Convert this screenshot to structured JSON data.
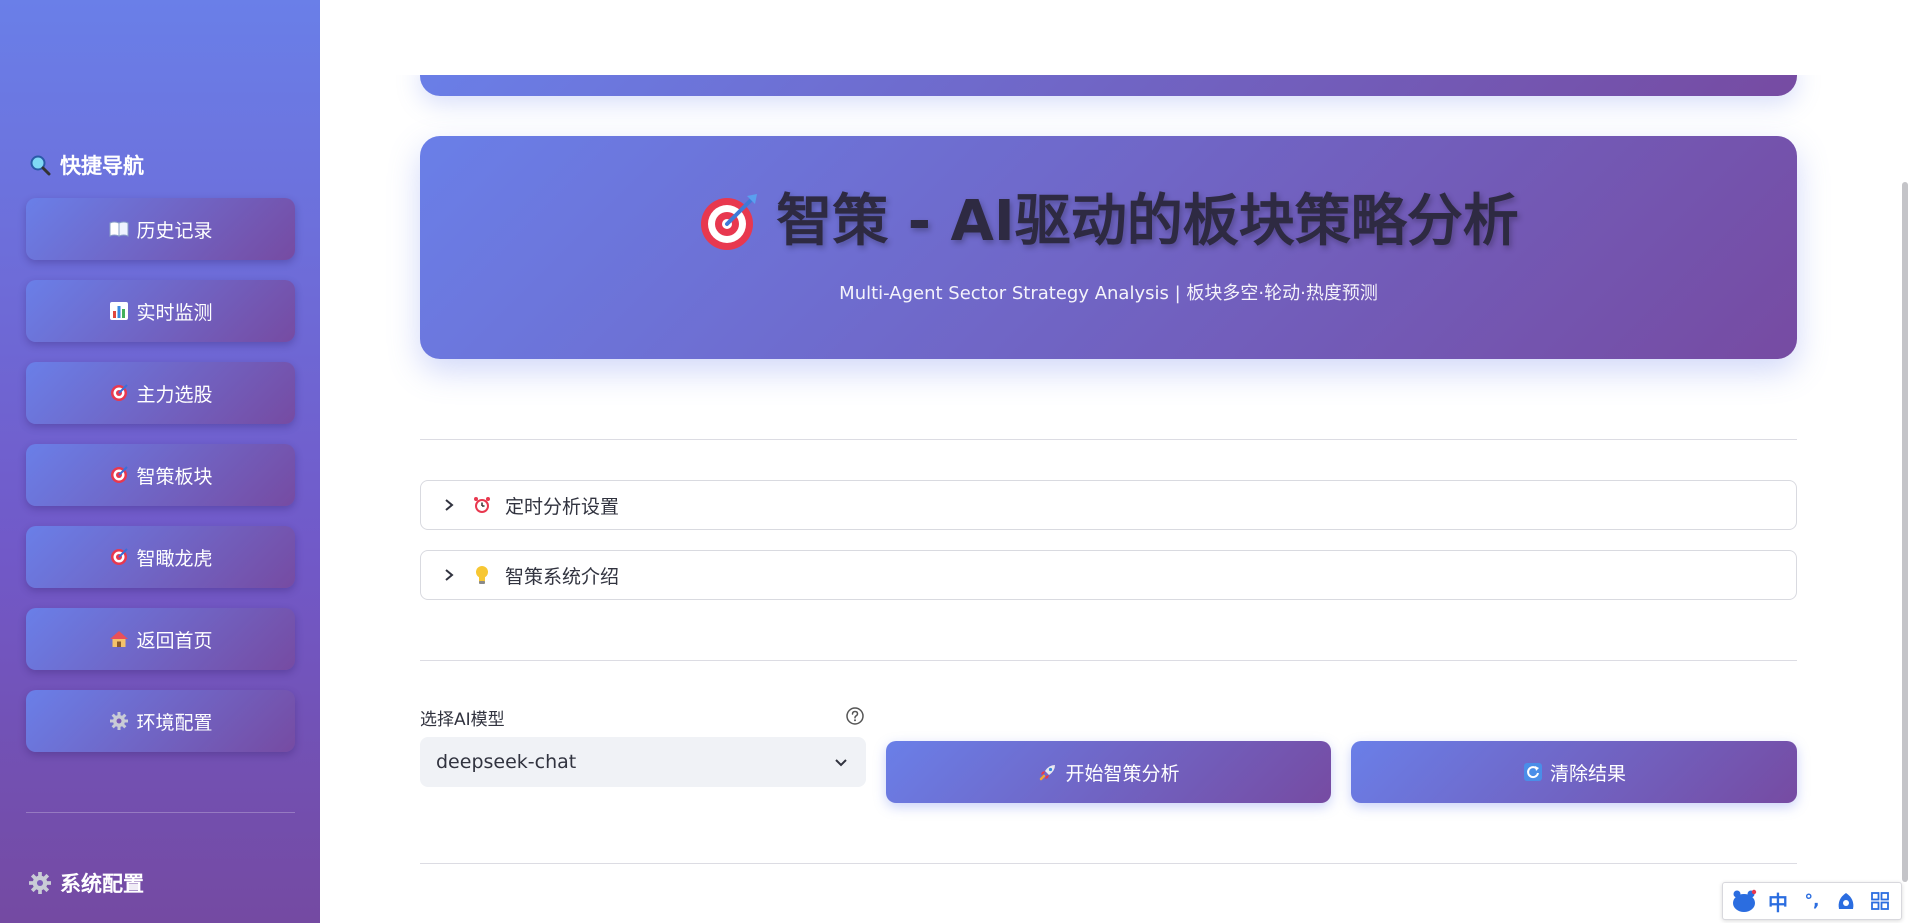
{
  "sidebar": {
    "quick_nav_title": "快捷导航",
    "items": [
      {
        "label": "历史记录",
        "icon": "book-icon"
      },
      {
        "label": "实时监测",
        "icon": "chart-icon"
      },
      {
        "label": "主力选股",
        "icon": "target-icon"
      },
      {
        "label": "智策板块",
        "icon": "target-icon"
      },
      {
        "label": "智瞰龙虎",
        "icon": "target-icon"
      },
      {
        "label": "返回首页",
        "icon": "house-icon"
      },
      {
        "label": "环境配置",
        "icon": "gear-icon"
      }
    ],
    "system_config_title": "系统配置"
  },
  "hero": {
    "title": "智策 - AI驱动的板块策略分析",
    "subtitle": "Multi-Agent Sector Strategy Analysis | 板块多空·轮动·热度预测"
  },
  "expanders": [
    {
      "label": "定时分析设置",
      "icon": "alarm-clock-icon"
    },
    {
      "label": "智策系统介绍",
      "icon": "lightbulb-icon"
    }
  ],
  "model": {
    "label": "选择AI模型",
    "selected": "deepseek-chat"
  },
  "buttons": {
    "start": "开始智策分析",
    "clear": "清除结果"
  },
  "ime": {
    "mode": "中",
    "punct": "°,"
  },
  "colors": {
    "gradient_start": "#6a7fe8",
    "gradient_end": "#764ba2",
    "text_dark": "#31333f"
  }
}
